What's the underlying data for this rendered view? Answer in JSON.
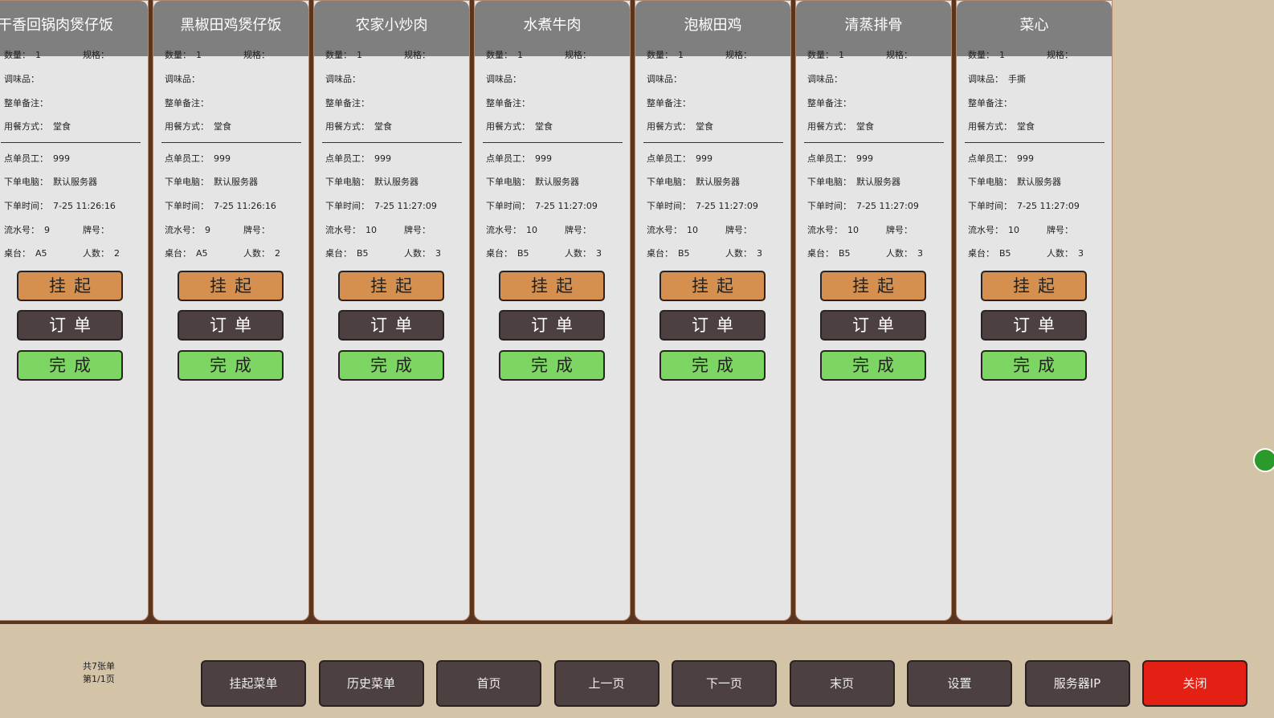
{
  "labels": {
    "qty": "数量：",
    "spec": "规格：",
    "seasoning": "调味品：",
    "note": "整单备注：",
    "dine": "用餐方式：",
    "staff": "点单员工：",
    "pc": "下单电脑：",
    "time": "下单时间：",
    "serial": "流水号：",
    "plate": "牌号：",
    "table": "桌台：",
    "people": "人数："
  },
  "buttons": {
    "hold": "挂起",
    "order": "订单",
    "done": "完成"
  },
  "orders": [
    {
      "name": "干香回锅肉煲仔饭",
      "qty": "1",
      "seasoning": "",
      "dine": "堂食",
      "staff": "999",
      "pc": "默认服务器",
      "time": "7-25 11:26:16",
      "serial": "9",
      "table": "A5",
      "people": "2"
    },
    {
      "name": "黑椒田鸡煲仔饭",
      "qty": "1",
      "seasoning": "",
      "dine": "堂食",
      "staff": "999",
      "pc": "默认服务器",
      "time": "7-25 11:26:16",
      "serial": "9",
      "table": "A5",
      "people": "2"
    },
    {
      "name": "农家小炒肉",
      "qty": "1",
      "seasoning": "",
      "dine": "堂食",
      "staff": "999",
      "pc": "默认服务器",
      "time": "7-25 11:27:09",
      "serial": "10",
      "table": "B5",
      "people": "3"
    },
    {
      "name": "水煮牛肉",
      "qty": "1",
      "seasoning": "",
      "dine": "堂食",
      "staff": "999",
      "pc": "默认服务器",
      "time": "7-25 11:27:09",
      "serial": "10",
      "table": "B5",
      "people": "3"
    },
    {
      "name": "泡椒田鸡",
      "qty": "1",
      "seasoning": "",
      "dine": "堂食",
      "staff": "999",
      "pc": "默认服务器",
      "time": "7-25 11:27:09",
      "serial": "10",
      "table": "B5",
      "people": "3"
    },
    {
      "name": "清蒸排骨",
      "qty": "1",
      "seasoning": "",
      "dine": "堂食",
      "staff": "999",
      "pc": "默认服务器",
      "time": "7-25 11:27:09",
      "serial": "10",
      "table": "B5",
      "people": "3"
    },
    {
      "name": "菜心",
      "qty": "1",
      "seasoning": "手撕",
      "dine": "堂食",
      "staff": "999",
      "pc": "默认服务器",
      "time": "7-25 11:27:09",
      "serial": "10",
      "table": "B5",
      "people": "3"
    }
  ],
  "footer": {
    "total": "共7张单",
    "page": "第1/1页",
    "buttons": [
      "挂起菜单",
      "历史菜单",
      "首页",
      "上一页",
      "下一页",
      "末页",
      "设置",
      "服务器IP",
      "关闭"
    ]
  }
}
